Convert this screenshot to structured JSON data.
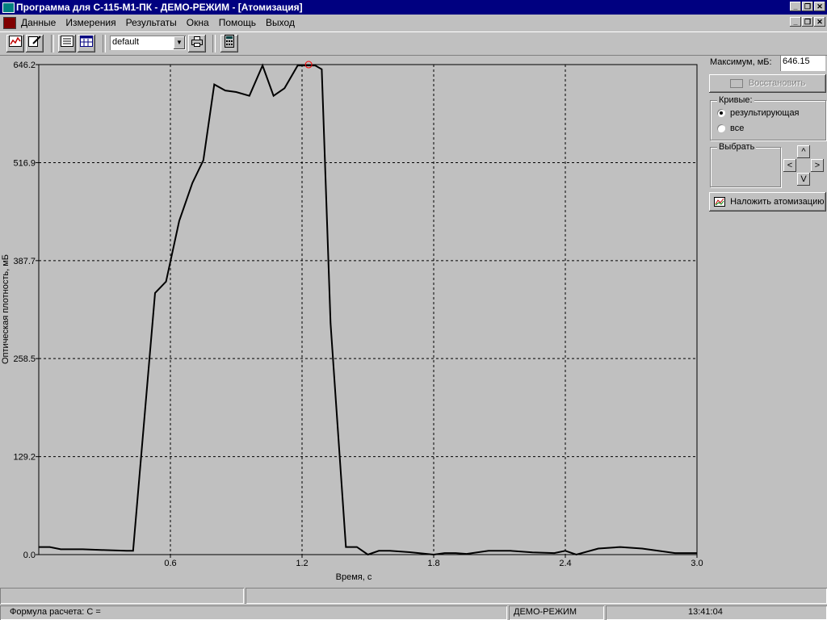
{
  "window": {
    "title": "Программа для С-115-М1-ПК - ДЕМО-РЕЖИМ - [Атомизация]",
    "controls": [
      "_",
      "❐",
      "✕"
    ]
  },
  "menu": {
    "items": [
      "Данные",
      "Измерения",
      "Результаты",
      "Окна",
      "Помощь",
      "Выход"
    ]
  },
  "toolbar": {
    "profile_value": "default"
  },
  "right_panel": {
    "max_label": "Максимум, мБ:",
    "max_value": "646.15",
    "restore_label": "Восстановить",
    "curves_group": "Кривые:",
    "radio_result": "результирующая",
    "radio_all": "все",
    "select_group": "Выбрать",
    "arrow_up": "^",
    "arrow_left": "<",
    "arrow_right": ">",
    "arrow_down": "V",
    "overlay_label": "Наложить атомизацию"
  },
  "status": {
    "formula": "Формула расчета: C =",
    "mode": "ДЕМО-РЕЖИМ",
    "time": "13:41:04"
  },
  "colors": {
    "title_bg": "#000080",
    "line": "#000000",
    "marker": "#ff0000",
    "grid": "#000000"
  },
  "chart_data": {
    "type": "line",
    "xlabel": "Время, с",
    "ylabel": "Оптическая плотность, мБ",
    "xlim": [
      0,
      3.0
    ],
    "ylim": [
      0,
      646.2
    ],
    "x_ticks": [
      0.6,
      1.2,
      1.8,
      2.4,
      3.0
    ],
    "x_tick_labels": [
      "0.6",
      "1.2",
      "1.8",
      "2.4",
      "3.0"
    ],
    "y_ticks": [
      0,
      129.2,
      258.5,
      387.7,
      516.9,
      646.2
    ],
    "y_tick_labels": [
      "0.0",
      "129.2",
      "258.5",
      "387.7",
      "516.9",
      "646.2"
    ],
    "grid": true,
    "series": [
      {
        "x": [
          0.0,
          0.05,
          0.1,
          0.2,
          0.3,
          0.4,
          0.43,
          0.53,
          0.58,
          0.64,
          0.7,
          0.75,
          0.8,
          0.85,
          0.9,
          0.96,
          1.02,
          1.07,
          1.12,
          1.18,
          1.22,
          1.26,
          1.29,
          1.33,
          1.4,
          1.45,
          1.5,
          1.55,
          1.6,
          1.7,
          1.8,
          1.85,
          1.9,
          1.95,
          2.05,
          2.15,
          2.25,
          2.35,
          2.4,
          2.45,
          2.55,
          2.65,
          2.75,
          2.9,
          3.0
        ],
        "y": [
          10,
          10,
          7,
          7,
          6,
          5,
          5,
          345,
          360,
          440,
          490,
          520,
          620,
          612,
          610,
          605,
          645,
          605,
          615,
          645,
          645,
          645,
          640,
          305,
          10,
          10,
          0,
          5,
          5,
          3,
          0,
          2,
          2,
          1,
          5,
          5,
          3,
          2,
          5,
          0,
          8,
          10,
          8,
          2,
          2
        ]
      }
    ],
    "max_marker": {
      "x": 1.23,
      "y": 646.15
    }
  }
}
